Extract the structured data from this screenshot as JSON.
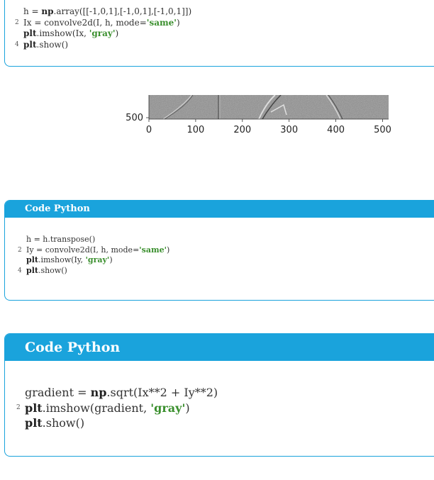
{
  "code_block_1": {
    "lines": [
      {
        "num": "",
        "parts": [
          [
            "t",
            "h = "
          ],
          [
            "kw",
            "np"
          ],
          [
            "t",
            ".array([[-1,0,1],[-1,0,1],[-1,0,1]])"
          ]
        ]
      },
      {
        "num": "2",
        "parts": [
          [
            "t",
            "Ix = convolve2d(I, h, mode="
          ],
          [
            "str",
            "'same'"
          ],
          [
            "t",
            ")"
          ]
        ]
      },
      {
        "num": "",
        "parts": [
          [
            "kw",
            "plt"
          ],
          [
            "t",
            ".imshow(Ix, "
          ],
          [
            "str",
            "'gray'"
          ],
          [
            "t",
            ")"
          ]
        ]
      },
      {
        "num": "4",
        "parts": [
          [
            "kw",
            "plt"
          ],
          [
            "t",
            ".show()"
          ]
        ]
      }
    ]
  },
  "figure": {
    "ytick": "500",
    "xticks": [
      "0",
      "100",
      "200",
      "300",
      "400",
      "500"
    ]
  },
  "code_block_2": {
    "title": "Code Python",
    "lines": [
      {
        "num": "",
        "parts": [
          [
            "t",
            "h = h.transpose()"
          ]
        ]
      },
      {
        "num": "2",
        "parts": [
          [
            "t",
            "Iy = convolve2d(I, h, mode="
          ],
          [
            "str",
            "'same'"
          ],
          [
            "t",
            ")"
          ]
        ]
      },
      {
        "num": "",
        "parts": [
          [
            "kw",
            "plt"
          ],
          [
            "t",
            ".imshow(Iy, "
          ],
          [
            "str",
            "'gray'"
          ],
          [
            "t",
            ")"
          ]
        ]
      },
      {
        "num": "4",
        "parts": [
          [
            "kw",
            "plt"
          ],
          [
            "t",
            ".show()"
          ]
        ]
      }
    ]
  },
  "code_block_3": {
    "title": "Code Python",
    "lines": [
      {
        "num": "",
        "parts": [
          [
            "t",
            "gradient = "
          ],
          [
            "kw",
            "np"
          ],
          [
            "t",
            ".sqrt(Ix**2 + Iy**2)"
          ]
        ]
      },
      {
        "num": "2",
        "parts": [
          [
            "kw",
            "plt"
          ],
          [
            "t",
            ".imshow(gradient, "
          ],
          [
            "str",
            "'gray'"
          ],
          [
            "t",
            ")"
          ]
        ]
      },
      {
        "num": "",
        "parts": [
          [
            "kw",
            "plt"
          ],
          [
            "t",
            ".show()"
          ]
        ]
      }
    ]
  }
}
